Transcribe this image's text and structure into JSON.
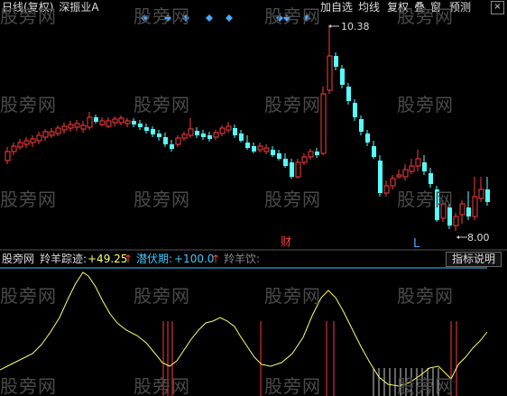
{
  "header": {
    "period": "日线",
    "adjust": "(复权)",
    "sector": "深振业A"
  },
  "toolbar": {
    "add_favorite": "加自选",
    "ma_lines": "均线",
    "adjust": "复权",
    "overlay": "叠",
    "window": "窗",
    "forecast": "预测",
    "close": "×"
  },
  "price_chart": {
    "high_label": "10.38",
    "low_label": "8.00",
    "fin_marker": "财",
    "l_marker": "L"
  },
  "indicator": {
    "source": "股旁网",
    "name": "羚羊踪迹:",
    "value": "+49.25",
    "up_arrow": "↑",
    "latent_label": "潜伏期:",
    "latent_value": "+100.0",
    "latent_arrow": "↑",
    "drink_label": "羚羊饮:",
    "explain_button": "指标说明"
  },
  "watermark_text": "股旁网",
  "colors": {
    "up": "#ff3c3c",
    "down": "#54ffff",
    "line": "#ffff66",
    "cyan_line": "#3cc8ff",
    "diamond": "#4aa8ff"
  }
}
